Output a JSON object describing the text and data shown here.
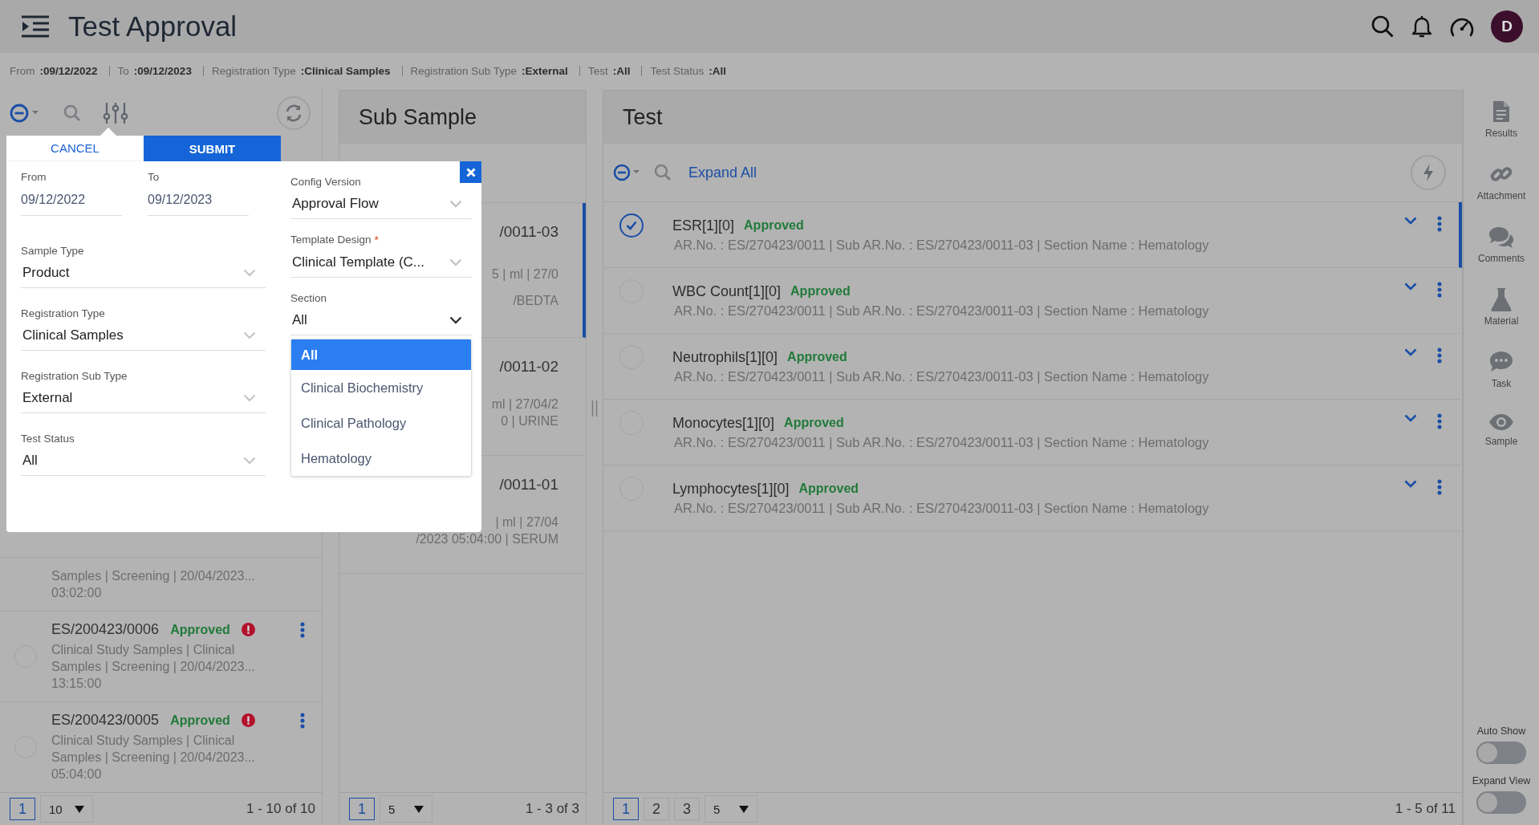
{
  "header": {
    "title": "Test Approval",
    "avatar": "D"
  },
  "filters": [
    {
      "label": "From",
      "value": ":09/12/2022"
    },
    {
      "label": "To",
      "value": ":09/12/2023"
    },
    {
      "label": "Registration Type",
      "value": ":Clinical Samples"
    },
    {
      "label": "Registration Sub Type",
      "value": ":External"
    },
    {
      "label": "Test",
      "value": ":All"
    },
    {
      "label": "Test Status",
      "value": ":All"
    }
  ],
  "sample_list": {
    "items": [
      {
        "lines": [
          "Samples | Screening | 20/04/2023...",
          "03:02:00"
        ]
      },
      {
        "id": "ES/200423/0006",
        "status": "Approved",
        "selected": false,
        "lines": [
          "Clinical Study Samples | Clinical",
          "Samples | Screening | 20/04/2023...",
          "13:15:00"
        ]
      },
      {
        "id": "ES/200423/0005",
        "status": "Approved",
        "selected": false,
        "lines": [
          "Clinical Study Samples | Clinical",
          "Samples | Screening | 20/04/2023...",
          "05:04:00"
        ]
      }
    ],
    "pager": {
      "pages": [
        {
          "label": "1",
          "selected": true
        }
      ],
      "page_size": "10",
      "range": "1 - 10 of 10"
    }
  },
  "sub_sample": {
    "title": "Sub Sample",
    "items": [
      {
        "selected": true,
        "lines": [
          "/0011-03",
          "5 | ml | 27/0",
          "/BEDTA"
        ]
      },
      {
        "selected": false,
        "lines": [
          "/0011-02",
          "ml | 27/04/2",
          "0 | URINE"
        ]
      },
      {
        "selected": false,
        "lines": [
          "/0011-01",
          "| ml | 27/04",
          "/2023 05:04:00 | SERUM"
        ]
      }
    ],
    "pager": {
      "pages": [
        {
          "label": "1",
          "selected": true
        }
      ],
      "page_size": "5",
      "range": "1 - 3 of 3"
    }
  },
  "test": {
    "title": "Test",
    "expand_all": "Expand All",
    "rows": [
      {
        "name": "ESR[1][0]",
        "status": "Approved",
        "selected": true,
        "details": "AR.No. : ES/270423/0011 | Sub AR.No. : ES/270423/0011-03 | Section Name : Hematology"
      },
      {
        "name": "WBC Count[1][0]",
        "status": "Approved",
        "selected": false,
        "details": "AR.No. : ES/270423/0011 | Sub AR.No. : ES/270423/0011-03 | Section Name : Hematology"
      },
      {
        "name": "Neutrophils[1][0]",
        "status": "Approved",
        "selected": false,
        "details": "AR.No. : ES/270423/0011 | Sub AR.No. : ES/270423/0011-03 | Section Name : Hematology"
      },
      {
        "name": "Monocytes[1][0]",
        "status": "Approved",
        "selected": false,
        "details": "AR.No. : ES/270423/0011 | Sub AR.No. : ES/270423/0011-03 | Section Name : Hematology"
      },
      {
        "name": "Lymphocytes[1][0]",
        "status": "Approved",
        "selected": false,
        "details": "AR.No. : ES/270423/0011 | Sub AR.No. : ES/270423/0011-03 | Section Name : Hematology"
      }
    ],
    "pager": {
      "pages": [
        {
          "label": "1",
          "selected": true
        },
        {
          "label": "2",
          "selected": false
        },
        {
          "label": "3",
          "selected": false
        }
      ],
      "page_size": "5",
      "range": "1 - 5 of 11"
    }
  },
  "side_tools": [
    {
      "label": "Results",
      "kind": "document"
    },
    {
      "label": "Attachment",
      "kind": "link"
    },
    {
      "label": "Comments",
      "kind": "comments"
    },
    {
      "label": "Material",
      "kind": "flask"
    },
    {
      "label": "Task",
      "kind": "task"
    },
    {
      "label": "Sample",
      "kind": "eye"
    }
  ],
  "toggles": [
    {
      "label": "Auto Show",
      "on": false
    },
    {
      "label": "Expand View",
      "on": false
    }
  ],
  "filter_popup": {
    "cancel": "CANCEL",
    "submit": "SUBMIT",
    "dates": [
      {
        "label": "From",
        "value": "09/12/2022"
      },
      {
        "label": "To",
        "value": "09/12/2023"
      }
    ],
    "left_fields": [
      {
        "label": "Sample Type",
        "value": "Product"
      },
      {
        "label": "Registration Type",
        "value": "Clinical Samples"
      },
      {
        "label": "Registration Sub Type",
        "value": "External"
      },
      {
        "label": "Test Status",
        "value": "All"
      }
    ],
    "right_fields": [
      {
        "label": "Config Version",
        "value": "Approval Flow",
        "open": false
      },
      {
        "label": "Template Design",
        "marker": "*",
        "value": "Clinical Template (C...",
        "open": false
      },
      {
        "label": "Section",
        "value": "All",
        "open": true
      }
    ],
    "section_options": [
      {
        "label": "All",
        "selected": true
      },
      {
        "label": "Clinical Biochemistry",
        "selected": false
      },
      {
        "label": "Clinical Pathology",
        "selected": false
      },
      {
        "label": "Hematology",
        "selected": false
      }
    ]
  }
}
